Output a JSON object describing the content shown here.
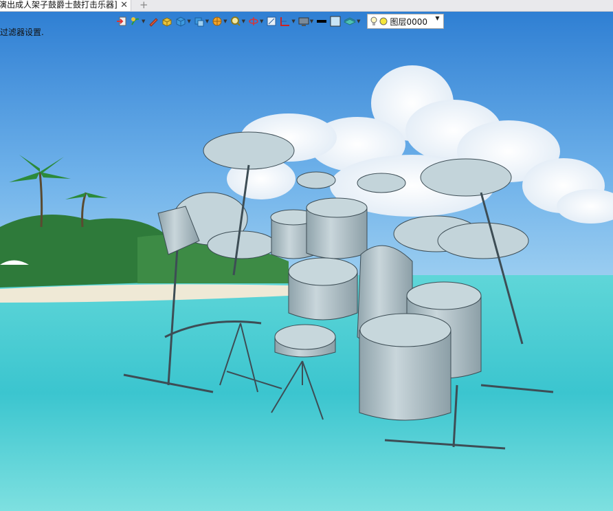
{
  "document_tab": {
    "title": "演出成人架子鼓爵士鼓打击乐器]",
    "close": "✕",
    "new_tab": "+"
  },
  "viewport": {
    "status_message": "过滤器设置."
  },
  "toolbar": {
    "items": [
      {
        "icon": "exit-sketch-icon",
        "dropdown": false
      },
      {
        "icon": "sketch-tools-icon",
        "dropdown": true
      },
      {
        "icon": "pencil-icon",
        "dropdown": false
      },
      {
        "icon": "solid-box-icon",
        "dropdown": false
      },
      {
        "icon": "view-cube-icon",
        "dropdown": true
      },
      {
        "icon": "display-style-icon",
        "dropdown": true
      },
      {
        "icon": "render-sphere-icon",
        "dropdown": true
      },
      {
        "icon": "zoom-icon",
        "dropdown": true
      },
      {
        "icon": "rotate-axis-icon",
        "dropdown": true
      },
      {
        "icon": "single-view-icon",
        "dropdown": false
      },
      {
        "icon": "split-view-icon",
        "dropdown": true
      },
      {
        "icon": "monitor-icon",
        "dropdown": true
      },
      {
        "icon": "black-line-icon",
        "dropdown": false
      },
      {
        "icon": "color-swatch-icon",
        "dropdown": false
      },
      {
        "icon": "layers-icon",
        "dropdown": true
      }
    ],
    "layer": {
      "name": "图层0000",
      "bulb_color": "#f5e63a"
    }
  },
  "colors": {
    "sky": "#4f9be0",
    "sea": "#3cc7cf",
    "drum": "#b7c7ce",
    "sand": "#efe9d6"
  }
}
